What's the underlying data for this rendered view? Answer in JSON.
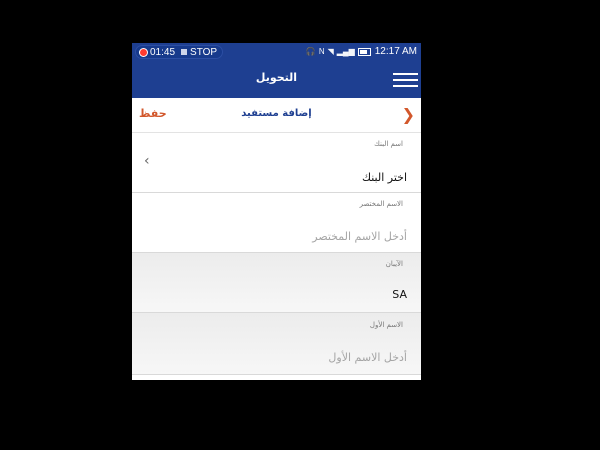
{
  "statusbar": {
    "rec_time": "01:45",
    "stop_label": "STOP",
    "clock": "12:17 AM",
    "icons": [
      "headset-icon",
      "nfc-icon",
      "wifi-icon",
      "signal-icon",
      "battery-icon"
    ]
  },
  "appbar": {
    "title": "التحويل"
  },
  "subheader": {
    "title": "إضافة مستفيد",
    "save_label": "حفظ"
  },
  "form": {
    "bank": {
      "label": "اسم البنك",
      "value": "اختر البنك"
    },
    "short_name": {
      "label": "الاسم المختصر",
      "placeholder": "أدخل الاسم المختصر"
    },
    "iban": {
      "label": "الآيبان",
      "value": "SA"
    },
    "first_name": {
      "label": "الاسم الأول",
      "placeholder": "أدخل الاسم الأول"
    }
  },
  "colors": {
    "primary": "#1e3f91",
    "accent": "#d2572b"
  }
}
